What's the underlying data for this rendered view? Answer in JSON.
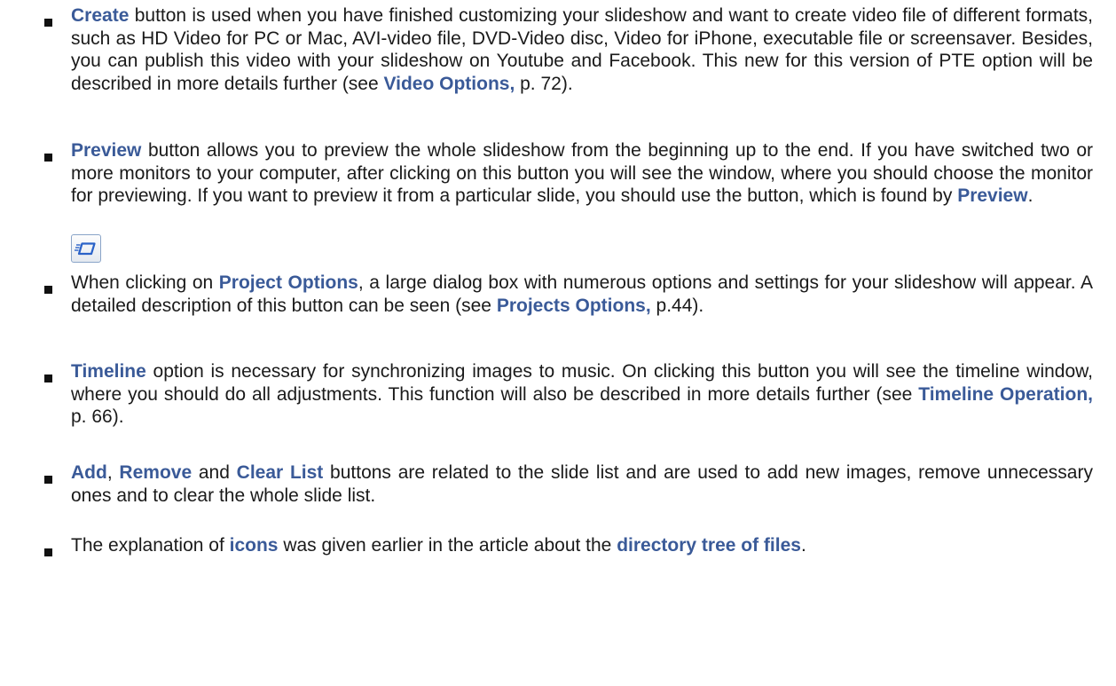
{
  "items": [
    {
      "id": "create",
      "parts": [
        {
          "k": 1,
          "t": "Create"
        },
        {
          "k": 0,
          "t": " button is used when you have finished customizing your slideshow and want to create video file of different formats, such as HD Video for PC or Mac, AVI-video file, DVD-Video disc, Video for iPhone, executable file or screensaver. Besides, you can publish this video with your slideshow on Youtube and Facebook. This new for this version of PTE option will be described in more details further (see "
        },
        {
          "k": 1,
          "t": "Video Options,"
        },
        {
          "k": 0,
          "t": " p. 72)."
        }
      ]
    },
    {
      "id": "preview",
      "parts": [
        {
          "k": 1,
          "t": "Preview"
        },
        {
          "k": 0,
          "t": " button allows you to preview the whole slideshow from the beginning up to the end. If you have switched two or more monitors to your computer, after clicking on this button you will see the window, where you should choose the monitor for previewing. If you want to preview it from a particular slide, you should use the button, which is found by "
        },
        {
          "k": 1,
          "t": "Preview"
        },
        {
          "k": 0,
          "t": "."
        }
      ]
    },
    {
      "id": "project-options",
      "parts": [
        {
          "k": 0,
          "t": "When clicking on "
        },
        {
          "k": 1,
          "t": "Project Options"
        },
        {
          "k": 0,
          "t": ", a large dialog box with numerous options and settings for your slideshow will appear. A detailed description of this button can be seen (see "
        },
        {
          "k": 1,
          "t": "Projects Options,"
        },
        {
          "k": 0,
          "t": " p.44)."
        }
      ]
    },
    {
      "id": "timeline",
      "parts": [
        {
          "k": 1,
          "t": "Timeline"
        },
        {
          "k": 0,
          "t": " option is necessary for synchronizing images to music. On clicking this button you will see the timeline window, where you should do all adjustments. This function will also be described in more details further (see "
        },
        {
          "k": 1,
          "t": "Timeline Operation,"
        },
        {
          "k": 0,
          "t": " p. 66)."
        }
      ]
    },
    {
      "id": "add-remove-clear",
      "parts": [
        {
          "k": 1,
          "t": "Add"
        },
        {
          "k": 0,
          "t": ", "
        },
        {
          "k": 1,
          "t": "Remove"
        },
        {
          "k": 0,
          "t": " and "
        },
        {
          "k": 1,
          "t": "Clear List"
        },
        {
          "k": 0,
          "t": " buttons are related to the slide list and are used to add new images, remove unnecessary ones and to clear the whole slide list."
        }
      ]
    },
    {
      "id": "icons",
      "parts": [
        {
          "k": 0,
          "t": "The explanation of "
        },
        {
          "k": 1,
          "t": "icons"
        },
        {
          "k": 0,
          "t": " was given earlier in the article about the "
        },
        {
          "k": 1,
          "t": "directory tree of files"
        },
        {
          "k": 0,
          "t": "."
        }
      ]
    }
  ],
  "preview_icon": {
    "icon": "slide-preview-icon",
    "border_color": "#8aa4c8",
    "glyph_color": "#2a62c8"
  },
  "link_color": "#3a5a98"
}
